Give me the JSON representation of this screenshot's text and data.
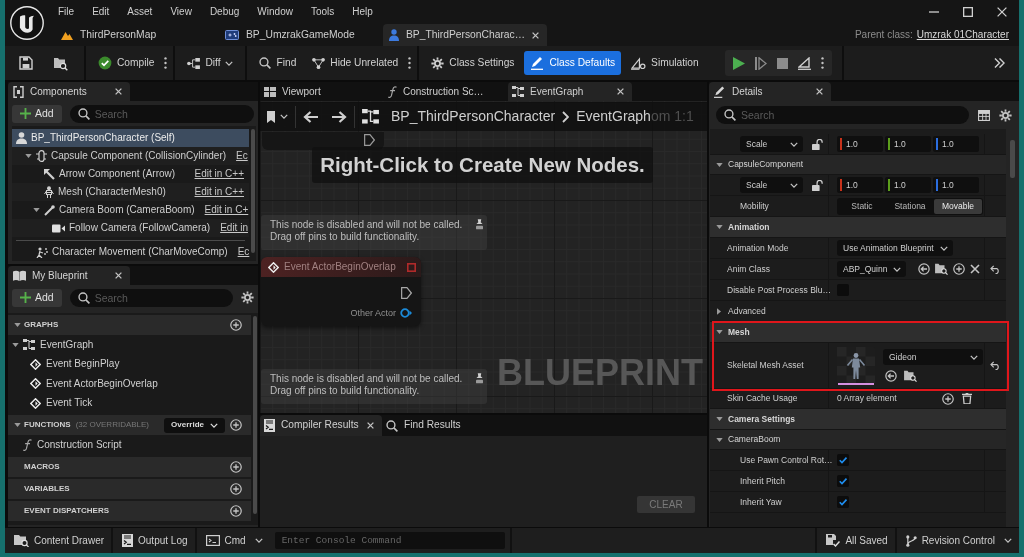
{
  "menu": [
    "File",
    "Edit",
    "Asset",
    "View",
    "Debug",
    "Window",
    "Tools",
    "Help"
  ],
  "document_tabs": [
    {
      "label": "ThirdPersonMap",
      "kind": "level",
      "selected": false
    },
    {
      "label": "BP_UmzrakGameMode",
      "kind": "blueprint",
      "selected": false
    },
    {
      "label": "BP_ThirdPersonCharac…",
      "kind": "character",
      "selected": true
    }
  ],
  "parent_class": {
    "label": "Parent class:",
    "value": "Umzrak 01Character"
  },
  "toolbar": {
    "compile": "Compile",
    "diff": "Diff",
    "find": "Find",
    "hide_unrelated": "Hide Unrelated",
    "modes": [
      {
        "label": "Class Settings",
        "selected": false
      },
      {
        "label": "Class Defaults",
        "selected": true
      }
    ],
    "simulation": "Simulation"
  },
  "components": {
    "title": "Components",
    "add": "Add",
    "search": {
      "placeholder": "Search"
    },
    "tree": [
      {
        "name": "BP_ThirdPersonCharacter (Self)",
        "kind": "self",
        "selected": true,
        "children": [
          {
            "name": "Capsule Component (CollisionCylinder)",
            "kind": "capsule",
            "edit": "Ec",
            "selected": false,
            "expanded": true,
            "children": [
              {
                "name": "Arrow Component (Arrow)",
                "kind": "arrow",
                "edit": "Edit in C++",
                "selected": false
              },
              {
                "name": "Mesh (CharacterMesh0)",
                "kind": "mesh",
                "edit": "Edit in C++",
                "selected": false
              },
              {
                "name": "Camera Boom (CameraBoom)",
                "kind": "boom",
                "edit": "Edit in C+",
                "selected": false,
                "expanded": true,
                "children": [
                  {
                    "name": "Follow Camera (FollowCamera)",
                    "kind": "camera",
                    "edit": "Edit in",
                    "selected": false
                  }
                ]
              }
            ]
          }
        ]
      }
    ],
    "other": [
      {
        "name": "Character Movement (CharMoveComp)",
        "kind": "movement",
        "edit": "Ec",
        "selected": false
      }
    ]
  },
  "my_blueprint": {
    "title": "My Blueprint",
    "add": "Add",
    "search": {
      "placeholder": "Search"
    },
    "sections": [
      {
        "title": "GRAPHS",
        "expanded": true,
        "items": [
          {
            "label": "EventGraph",
            "kind": "graph",
            "expanded": true,
            "children": [
              {
                "label": "Event BeginPlay",
                "kind": "event"
              },
              {
                "label": "Event ActorBeginOverlap",
                "kind": "event"
              },
              {
                "label": "Event Tick",
                "kind": "event"
              }
            ]
          }
        ]
      },
      {
        "title": "FUNCTIONS",
        "note": "(32 OVERRIDABLE)",
        "menu": "Override",
        "expanded": true,
        "items": [
          {
            "label": "Construction Script",
            "kind": "function"
          }
        ]
      },
      {
        "title": "MACROS"
      },
      {
        "title": "VARIABLES"
      },
      {
        "title": "EVENT DISPATCHERS"
      }
    ]
  },
  "graph_tabs": [
    {
      "label": "Viewport",
      "kind": "viewport",
      "selected": false
    },
    {
      "label": "Construction Sc…",
      "kind": "function",
      "selected": false
    },
    {
      "label": "EventGraph",
      "kind": "graph",
      "selected": true
    }
  ],
  "graph": {
    "breadcrumb": [
      "BP_ThirdPersonCharacter",
      "EventGraph"
    ],
    "zoom": "om 1:1",
    "hint": "Right-Click to Create New Nodes.",
    "watermark": "BLUEPRINT",
    "comments": [
      "This node is disabled and will not be called.\nDrag off pins to build functionality.",
      "This node is disabled and will not be called.\nDrag off pins to build functionality."
    ],
    "nodes": [
      {
        "title": "Event ActorBeginOverlap",
        "disabled": true,
        "pins": [
          "Other Actor"
        ]
      }
    ]
  },
  "results_tabs": [
    {
      "label": "Compiler Results",
      "kind": "log",
      "selected": true
    },
    {
      "label": "Find Results",
      "kind": "search",
      "selected": false
    }
  ],
  "clear_button": {
    "label": "CLEAR",
    "disabled": true
  },
  "details": {
    "title": "Details",
    "search": {
      "placeholder": "Search"
    },
    "rows": [
      {
        "kind": "vector",
        "menu": "Scale",
        "locked": false,
        "values": [
          {
            "value": "1.0",
            "color": "#c8321b"
          },
          {
            "value": "1.0",
            "color": "#5c9e1c"
          },
          {
            "value": "1.0",
            "color": "#2b6ee0"
          }
        ]
      },
      {
        "kind": "subsection",
        "label": "CapsuleComponent",
        "expanded": true,
        "rows": [
          {
            "kind": "vector",
            "menu": "Scale",
            "locked": false,
            "values": [
              {
                "value": "1.0",
                "color": "#c8321b"
              },
              {
                "value": "1.0",
                "color": "#5c9e1c"
              },
              {
                "value": "1.0",
                "color": "#2b6ee0"
              }
            ]
          },
          {
            "kind": "choice",
            "label": "Mobility",
            "options": [
              {
                "label": "Static",
                "selected": false
              },
              {
                "label": "Stationa",
                "selected": false
              },
              {
                "label": "Movable",
                "selected": true
              }
            ]
          }
        ]
      },
      {
        "kind": "section",
        "label": "Animation",
        "expanded": true,
        "rows": [
          {
            "kind": "dropdown",
            "label": "Animation Mode",
            "value": "Use Animation Blueprint"
          },
          {
            "kind": "class",
            "label": "Anim Class",
            "value": "ABP_Quinn",
            "modified": true
          },
          {
            "kind": "checkbox",
            "label": "Disable Post Process Blu…",
            "checked": false
          },
          {
            "kind": "advanced",
            "label": "Advanced",
            "expanded": false
          }
        ]
      },
      {
        "kind": "section",
        "label": "Mesh",
        "expanded": true,
        "highlighted": true,
        "rows": [
          {
            "kind": "asset",
            "label": "Skeletal Mesh Asset",
            "value": "Gideon",
            "modified": true,
            "highlighted": true
          },
          {
            "kind": "array",
            "label": "Skin Cache Usage",
            "value": "0 Array element"
          }
        ]
      },
      {
        "kind": "section",
        "label": "Camera Settings",
        "expanded": true,
        "rows": [
          {
            "kind": "subsection",
            "label": "CameraBoom",
            "expanded": true,
            "rows": [
              {
                "kind": "checkbox",
                "label": "Use Pawn Control Rot…",
                "checked": true
              },
              {
                "kind": "checkbox",
                "label": "Inherit Pitch",
                "checked": true
              },
              {
                "kind": "checkbox",
                "label": "Inherit Yaw",
                "checked": true
              }
            ]
          }
        ]
      }
    ]
  },
  "status_bar": {
    "content_drawer": "Content Drawer",
    "output_log": "Output Log",
    "cmd": "Cmd",
    "console": {
      "placeholder": "Enter Console Command"
    },
    "saved": "All Saved",
    "revision_control": "Revision Control"
  }
}
